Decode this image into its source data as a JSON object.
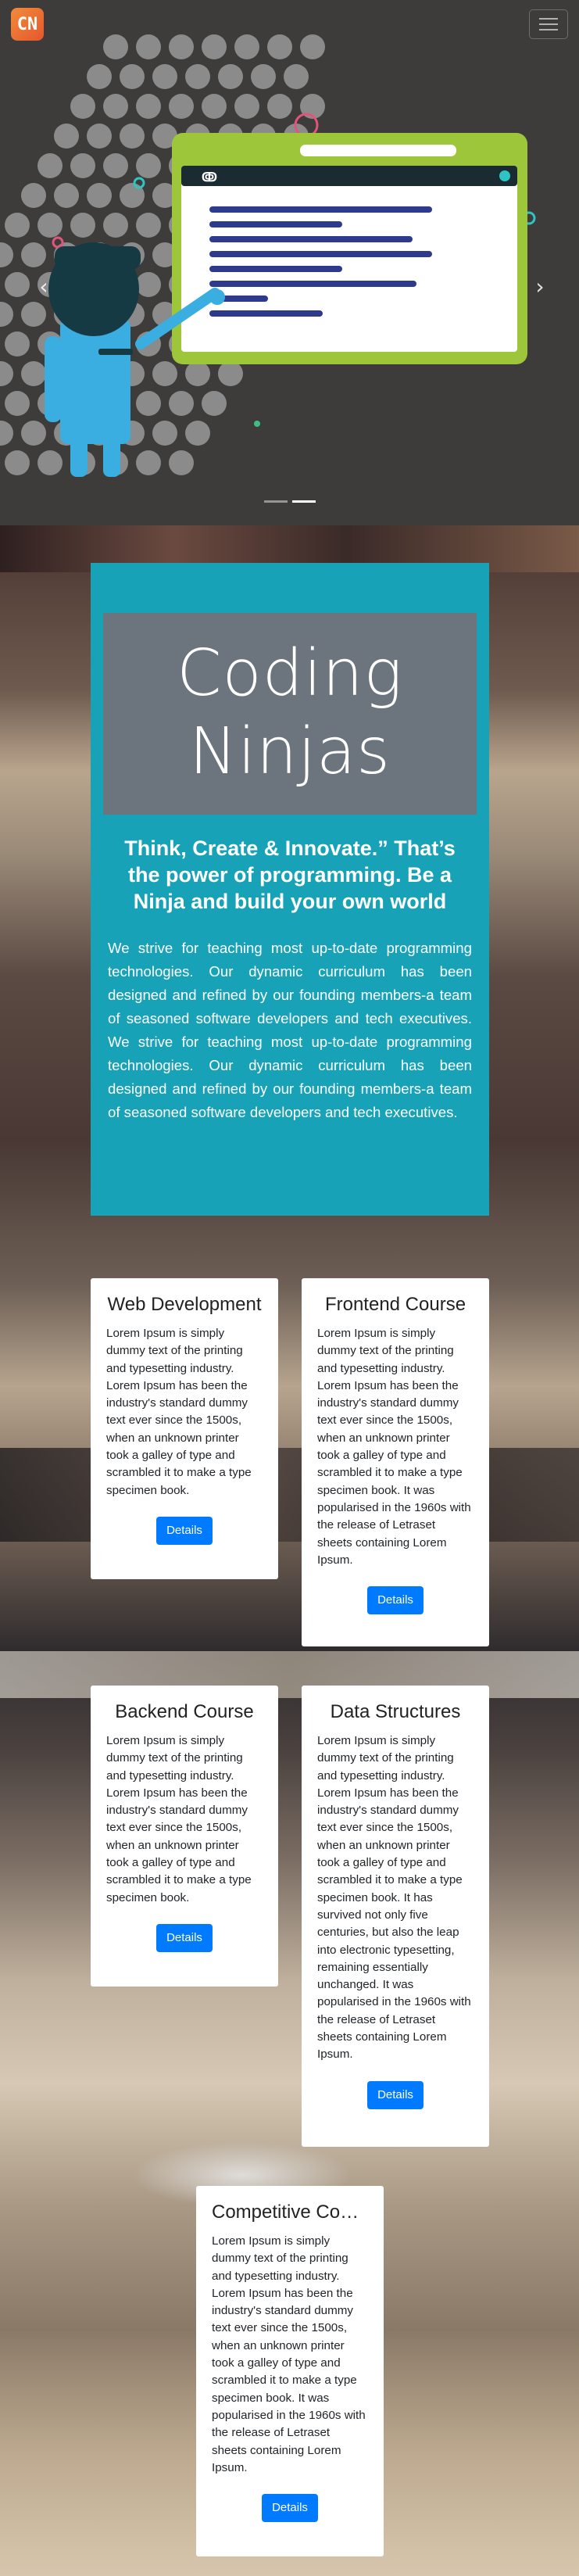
{
  "navbar": {
    "logo_text": "CN",
    "menu_icon": "hamburger-icon"
  },
  "carousel": {
    "prev_icon": "chevron-left-icon",
    "next_icon": "chevron-right-icon",
    "slide_count": 2,
    "active_slide": 2
  },
  "intro": {
    "title_line1": "Coding",
    "title_line2": "Ninjas",
    "lead": "Think, Create & Innovate.” That’s the power of programming. Be a Ninja and build your own world",
    "body": "We strive for teaching most up-to-date programming technologies. Our dynamic curriculum has been designed and refined by our founding members-a team of seasoned software developers and tech executives. We strive for teaching most up-to-date programming technologies. Our dynamic curriculum has been designed and refined by our founding members-a team of seasoned software developers and tech executives."
  },
  "cards": [
    {
      "title": "Web Development",
      "text": "Lorem Ipsum is simply dummy text of the printing and typesetting industry. Lorem Ipsum has been the industry's standard dummy text ever since the 1500s, when an unknown printer took a galley of type and scrambled it to make a type specimen book.",
      "button": "Details"
    },
    {
      "title": "Frontend Course",
      "text": "Lorem Ipsum is simply dummy text of the printing and typesetting industry. Lorem Ipsum has been the industry's standard dummy text ever since the 1500s, when an unknown printer took a galley of type and scrambled it to make a type specimen book. It was popularised in the 1960s with the release of Letraset sheets containing Lorem Ipsum.",
      "button": "Details"
    },
    {
      "title": "Backend Course",
      "text": "Lorem Ipsum is simply dummy text of the printing and typesetting industry. Lorem Ipsum has been the industry's standard dummy text ever since the 1500s, when an unknown printer took a galley of type and scrambled it to make a type specimen book.",
      "button": "Details"
    },
    {
      "title": "Data Structures",
      "text": "Lorem Ipsum is simply dummy text of the printing and typesetting industry. Lorem Ipsum has been the industry's standard dummy text ever since the 1500s, when an unknown printer took a galley of type and scrambled it to make a type specimen book. It has survived not only five centuries, but also the leap into electronic typesetting, remaining essentially unchanged. It was popularised in the 1960s with the release of Letraset sheets containing Lorem Ipsum.",
      "button": "Details"
    },
    {
      "title": "Competitive Coding",
      "text": "Lorem Ipsum is simply dummy text of the printing and typesetting industry. Lorem Ipsum has been the industry's standard dummy text ever since the 1500s, when an unknown printer took a galley of type and scrambled it to make a type specimen book. It was popularised in the 1960s with the release of Letraset sheets containing Lorem Ipsum.",
      "button": "Details"
    }
  ],
  "colors": {
    "intro_bg": "#17a2b8",
    "title_bg": "#6c757d",
    "button_bg": "#007bff",
    "hero_bg": "#3d3c3b",
    "illustration_frame": "#9dc63b"
  }
}
